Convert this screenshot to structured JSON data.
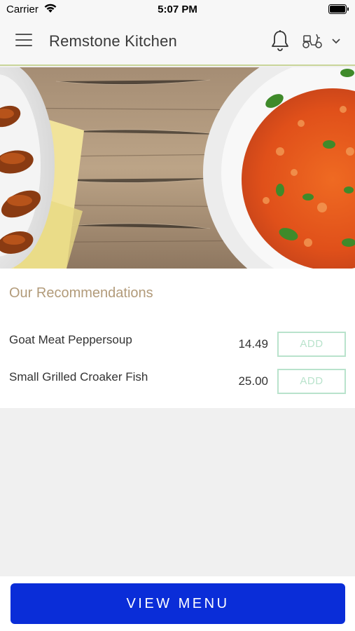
{
  "status_bar": {
    "carrier": "Carrier",
    "time": "5:07 PM",
    "wifi_icon": "wifi-icon",
    "battery_icon": "battery-icon"
  },
  "header": {
    "title": "Remstone Kitchen",
    "menu_icon": "hamburger-menu-icon",
    "bell_icon": "bell-icon",
    "delivery_icon": "scooter-icon",
    "dropdown_icon": "chevron-down-icon",
    "accent_border": "#c9d59a"
  },
  "hero": {
    "image": "food-banner-chicken-wings-and-jollof-rice"
  },
  "recommendations": {
    "title": "Our Recommendations",
    "items": [
      {
        "name": "Goat Meat Peppersoup",
        "price": "14.49",
        "action": "ADD"
      },
      {
        "name": "Small Grilled Croaker Fish",
        "price": "25.00",
        "action": "ADD"
      }
    ]
  },
  "footer": {
    "view_menu_label": "VIEW MENU",
    "button_color": "#0a2dd8"
  }
}
